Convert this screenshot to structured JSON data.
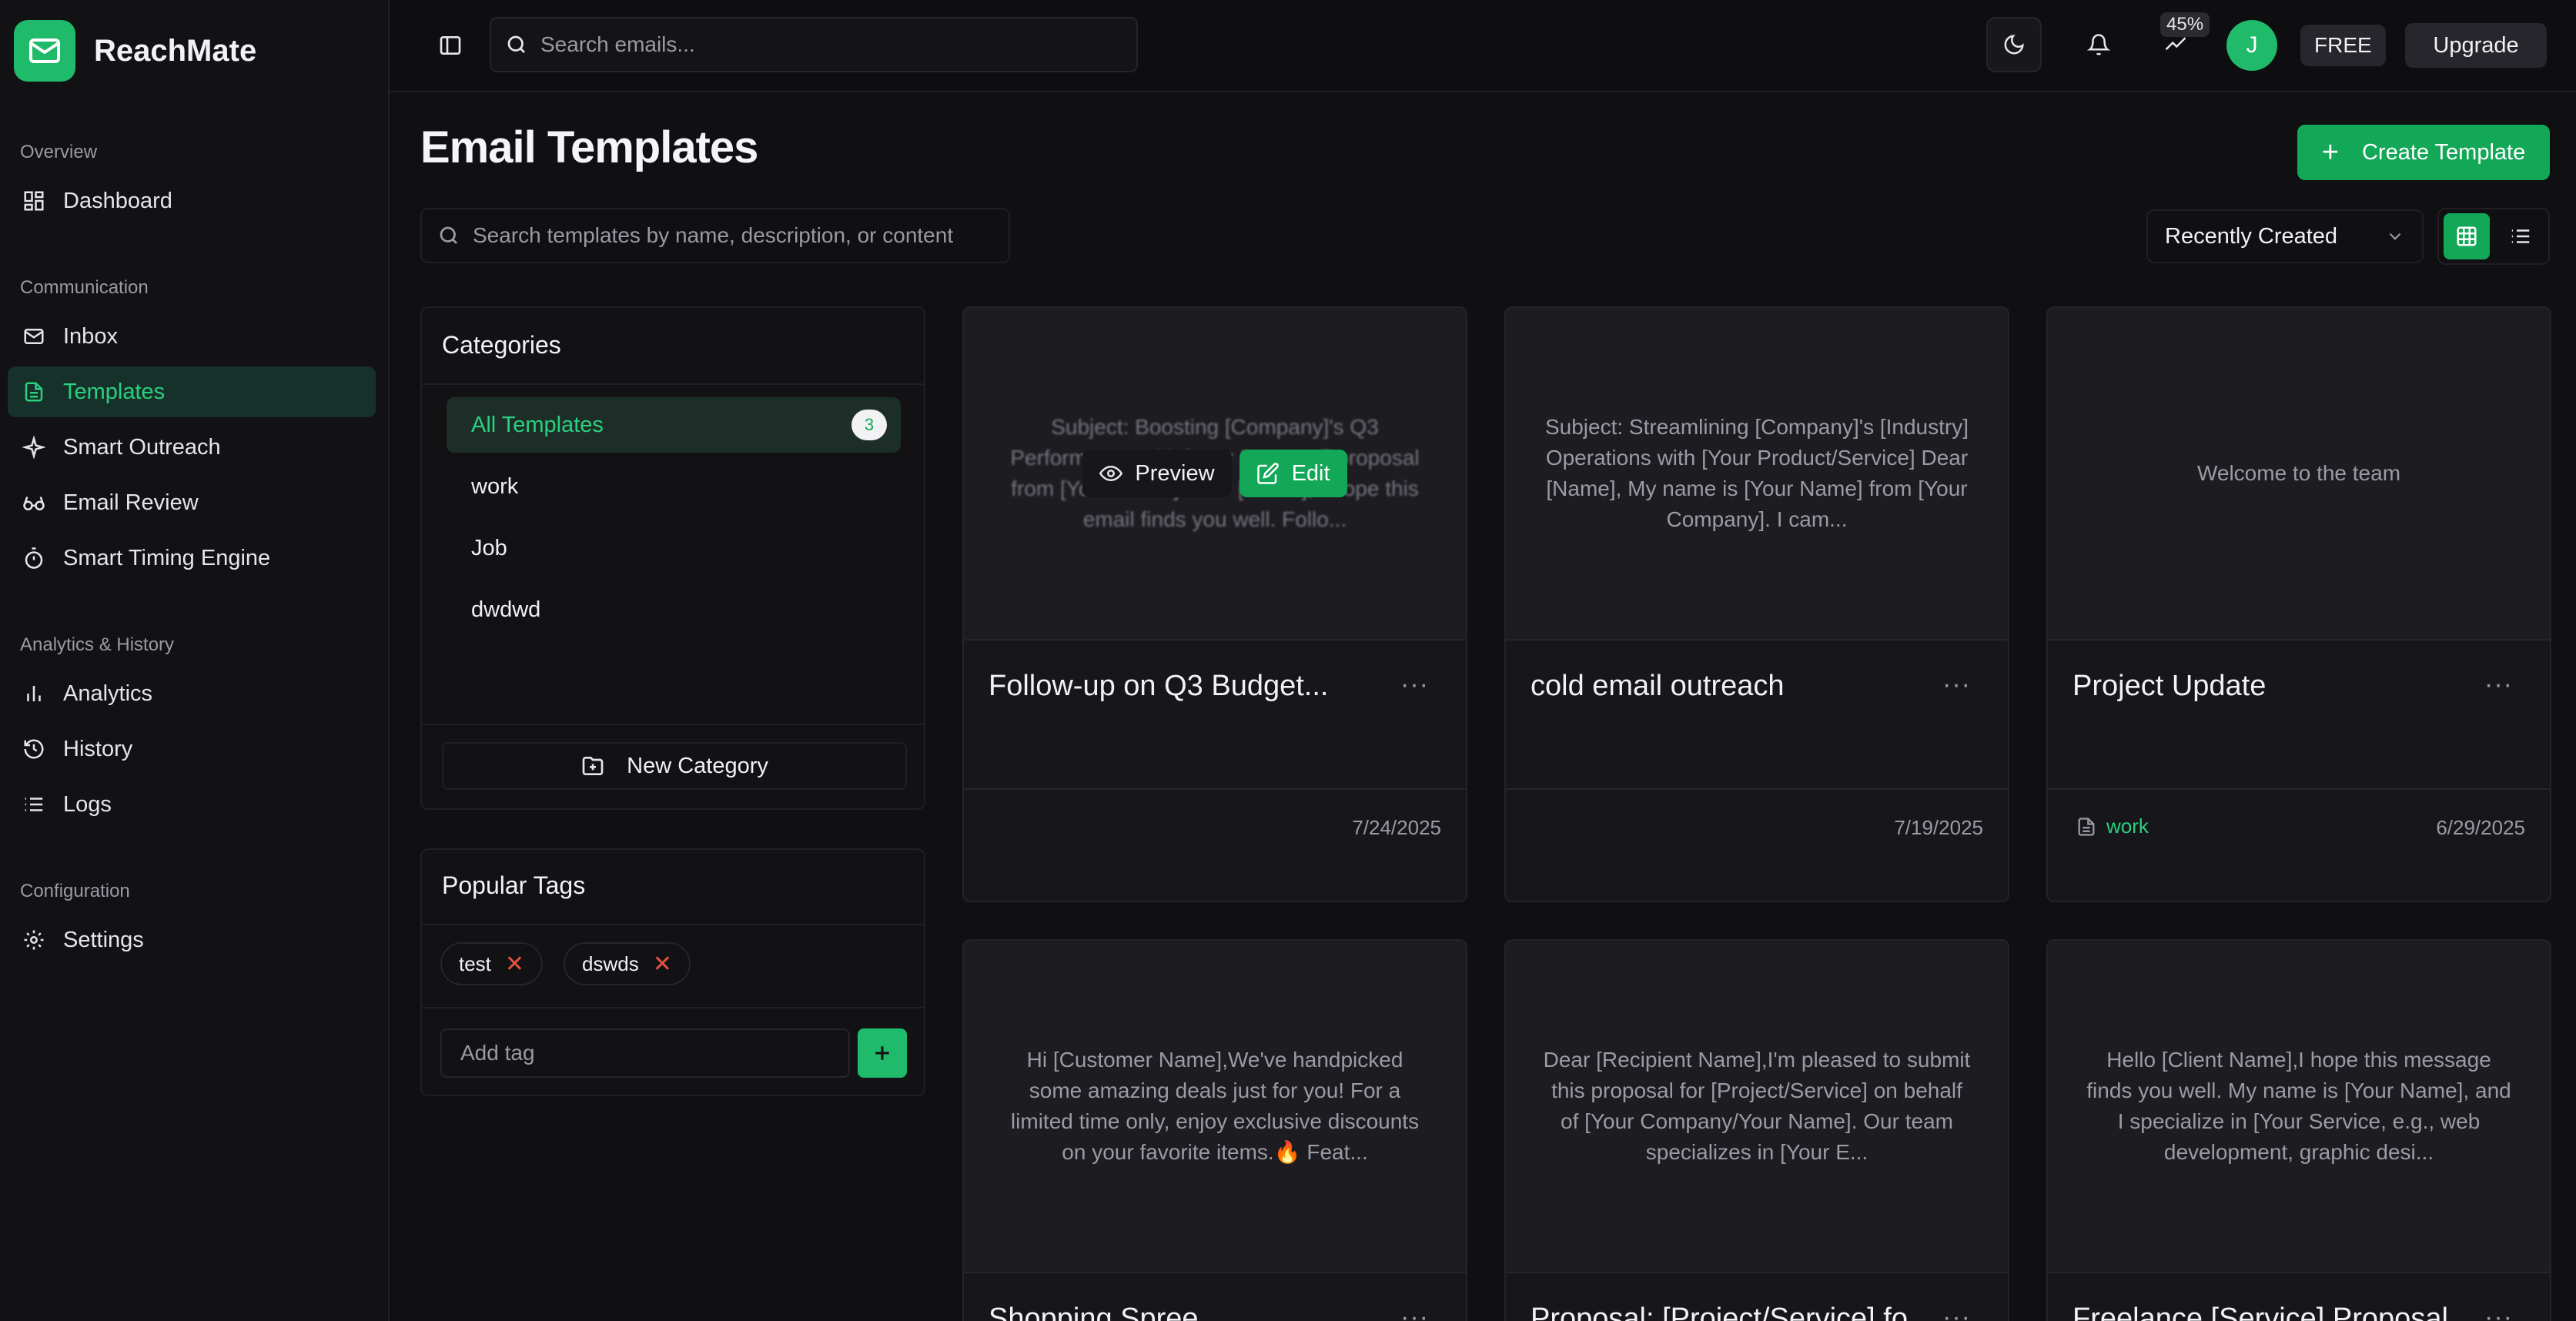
{
  "brand": {
    "name": "ReachMate"
  },
  "sidebar": {
    "sections": [
      {
        "title": "Overview"
      },
      {
        "title": "Communication"
      },
      {
        "title": "Analytics & History"
      },
      {
        "title": "Configuration"
      }
    ],
    "items": [
      {
        "label": "Dashboard",
        "icon": "dashboard-icon"
      },
      {
        "label": "Inbox",
        "icon": "mail-icon"
      },
      {
        "label": "Templates",
        "icon": "file-text-icon",
        "active": true
      },
      {
        "label": "Smart Outreach",
        "icon": "sparkle-icon"
      },
      {
        "label": "Email Review",
        "icon": "glasses-icon"
      },
      {
        "label": "Smart Timing Engine",
        "icon": "timer-icon"
      },
      {
        "label": "Analytics",
        "icon": "bar-chart-icon"
      },
      {
        "label": "History",
        "icon": "history-icon"
      },
      {
        "label": "Logs",
        "icon": "list-icon"
      },
      {
        "label": "Settings",
        "icon": "gear-icon"
      }
    ]
  },
  "header": {
    "search_placeholder": "Search emails...",
    "usage_percent": "45%",
    "avatar_initial": "J",
    "plan": "FREE",
    "upgrade_label": "Upgrade"
  },
  "main": {
    "title": "Email Templates",
    "create_label": "Create Template",
    "search_placeholder": "Search templates by name, description, or content",
    "sort_value": "Recently Created"
  },
  "categories": {
    "title": "Categories",
    "items": [
      {
        "label": "All Templates",
        "count": "3",
        "active": true
      },
      {
        "label": "work"
      },
      {
        "label": "Job"
      },
      {
        "label": "dwdwd"
      }
    ],
    "new_label": "New Category"
  },
  "tags": {
    "title": "Popular Tags",
    "items": [
      "test",
      "dswds"
    ],
    "input_placeholder": "Add tag"
  },
  "templates": [
    {
      "preview": "Subject: Boosting [Company]'s Q3 Performance with [Your Proposal] proposal from [Your Name] Dear [Name], I hope this email finds you well. Follo...",
      "title": "Follow-up on Q3 Budget...",
      "date": "7/24/2025",
      "tag": "",
      "overlay": {
        "preview_label": "Preview",
        "edit_label": "Edit"
      }
    },
    {
      "preview": "Subject: Streamlining [Company]'s [Industry] Operations with [Your Product/Service] Dear [Name], My name is [Your Name] from [Your Company]. I cam...",
      "title": "cold email outreach",
      "date": "7/19/2025",
      "tag": ""
    },
    {
      "preview": "Welcome to the team",
      "title": "Project Update",
      "date": "6/29/2025",
      "tag": "work"
    },
    {
      "preview": "Hi [Customer Name],We've handpicked some amazing deals just for you! For a limited time only, enjoy exclusive discounts on your favorite items.🔥 Feat...",
      "title": "Shopping Spree",
      "date": "",
      "tag": ""
    },
    {
      "preview": "Dear [Recipient Name],I'm pleased to submit this proposal for [Project/Service] on behalf of [Your Company/Your Name]. Our team specializes in [Your E...",
      "title": "Proposal: [Project/Service] fo...",
      "date": "",
      "tag": ""
    },
    {
      "preview": "Hello [Client Name],I hope this message finds you well. My name is [Your Name], and I specialize in [Your Service, e.g., web development, graphic desi...",
      "title": "Freelance [Service] Proposal",
      "date": "",
      "tag": ""
    }
  ],
  "colors": {
    "accent": "#13a857",
    "accent_text": "#2ad07f",
    "danger": "#e5533d"
  }
}
